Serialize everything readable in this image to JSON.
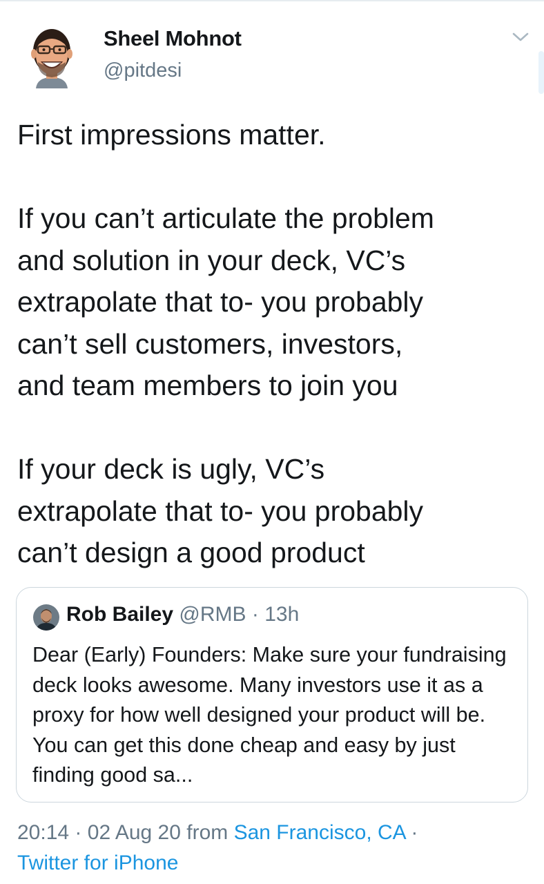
{
  "tweet": {
    "author": {
      "name": "Sheel Mohnot",
      "handle": "@pitdesi",
      "avatar_icon": "cartoon-avatar-icon"
    },
    "menu_icon": "chevron-down-icon",
    "paragraphs": [
      "First impressions matter.",
      "If you can’t articulate the problem\nand solution in your deck, VC’s\nextrapolate that to- you probably\ncan’t sell customers, investors,\nand team members to join you",
      "If your deck is ugly, VC’s\nextrapolate that to- you probably\ncan’t design a good product"
    ],
    "quoted_tweet": {
      "name": "Rob Bailey",
      "handle": "@RMB",
      "separator": "·",
      "time": "13h",
      "text": "Dear (Early) Founders: Make sure your fundraising deck looks awesome. Many investors use it as a proxy for how well designed your product will be. You can get this done cheap and easy by just finding good sa..."
    },
    "meta": {
      "time": "20:14",
      "separator": "·",
      "date": "02 Aug 20",
      "from_label": "from",
      "location": "San Francisco, CA",
      "separator2": "·",
      "source": "Twitter for iPhone"
    }
  },
  "colors": {
    "text": "#14171a",
    "secondary": "#657786",
    "link": "#1b95e0",
    "border": "#ccd6dd"
  }
}
